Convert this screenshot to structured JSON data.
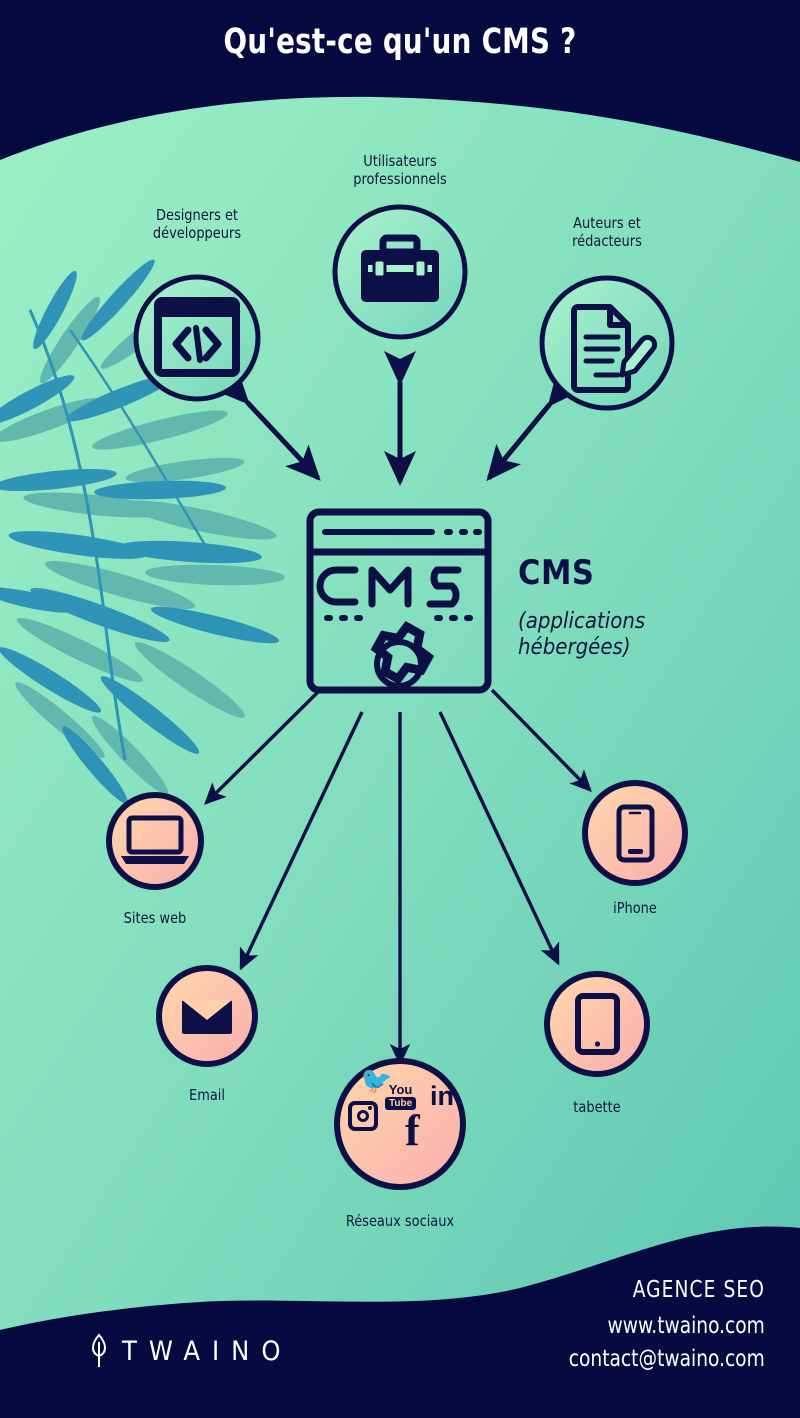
{
  "header": {
    "title": "Qu'est-ce qu'un CMS ?"
  },
  "colors": {
    "navy": "#060a40",
    "arrow_navy": "#0d1046",
    "bg_mint_light": "#9cf0c5",
    "bg_teal_dark": "#63ccb4",
    "circle_top_fill_a": "#a9f2cd",
    "circle_top_fill_b": "#74d6bb",
    "circle_bottom_fill_a": "#ffd9ab",
    "circle_bottom_fill_b": "#f9adaf",
    "text_navy": "#12173f",
    "white": "#ffffff",
    "bamboo_blue": "#2b8fb8",
    "bamboo_teal": "#5fb6ad"
  },
  "center": {
    "icon": "cms-browser-gear-icon",
    "screen_text": "CMS",
    "name": "CMS",
    "subtitle": "(applications\nhébergées)"
  },
  "inputs": [
    {
      "id": "designers",
      "label": "Designers et\ndéveloppeurs",
      "icon": "code-window-icon"
    },
    {
      "id": "pro-users",
      "label": "Utilisateurs\nprofessionnels",
      "icon": "briefcase-icon"
    },
    {
      "id": "authors",
      "label": "Auteurs et\nrédacteurs",
      "icon": "document-pencil-icon"
    }
  ],
  "outputs": [
    {
      "id": "websites",
      "label": "Sites web",
      "icon": "laptop-icon"
    },
    {
      "id": "email",
      "label": "Email",
      "icon": "envelope-icon"
    },
    {
      "id": "social",
      "label": "Réseaux sociaux",
      "icon": "social-networks-icon"
    },
    {
      "id": "iphone",
      "label": "iPhone",
      "icon": "smartphone-icon"
    },
    {
      "id": "tablet",
      "label": "tabette",
      "icon": "tablet-icon"
    }
  ],
  "social_icons": [
    "twitter-bird-icon",
    "youtube-icon",
    "linkedin-icon",
    "instagram-icon",
    "facebook-icon"
  ],
  "footer": {
    "logo_text": "TWAINO",
    "logo_icon": "leaf-icon",
    "agency": "AGENCE SEO",
    "website": "www.twaino.com",
    "email": "contact@twaino.com"
  }
}
